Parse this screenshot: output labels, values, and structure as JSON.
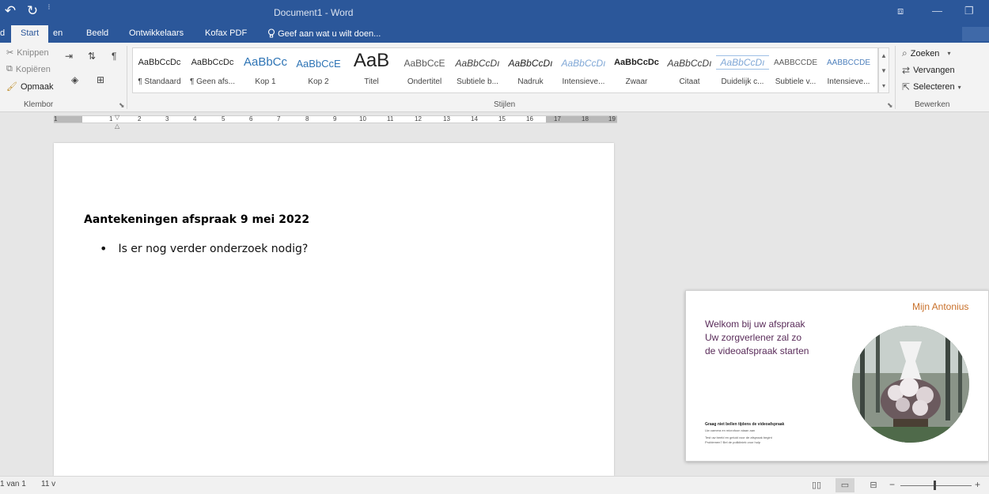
{
  "titlebar": {
    "title": "Document1 - Word",
    "qat": {
      "undo_icon": "↶",
      "redo_icon": "↻",
      "more_icon": "⁝"
    },
    "window_icons": {
      "ribbon_options": "⧈",
      "minimize": "—",
      "restore": "❐"
    }
  },
  "tabs": {
    "partial_left": "d",
    "items": [
      {
        "label": "Start"
      },
      {
        "label": "en"
      },
      {
        "label": "Beeld"
      },
      {
        "label": "Ontwikkelaars"
      },
      {
        "label": "Kofax PDF"
      }
    ],
    "tell_me": "Geef aan wat u wilt doen..."
  },
  "ribbon": {
    "clipboard": {
      "cut": "Knippen",
      "copy": "Kopiëren",
      "format_painter": "Opmaak",
      "group_label": "Klembor"
    },
    "styles": {
      "group_label": "Stijlen",
      "items": [
        {
          "sample": "AaBbCcDc",
          "name": "¶ Standaard"
        },
        {
          "sample": "AaBbCcDc",
          "name": "¶ Geen afs..."
        },
        {
          "sample": "AaBbCc",
          "name": "Kop 1"
        },
        {
          "sample": "AaBbCcE",
          "name": "Kop 2"
        },
        {
          "sample": "AaB",
          "name": "Titel"
        },
        {
          "sample": "AaBbCcE",
          "name": "Ondertitel"
        },
        {
          "sample": "AaBbCcDı",
          "name": "Subtiele b..."
        },
        {
          "sample": "AaBbCcDı",
          "name": "Nadruk"
        },
        {
          "sample": "AaBbCcDı",
          "name": "Intensieve..."
        },
        {
          "sample": "AaBbCcDc",
          "name": "Zwaar"
        },
        {
          "sample": "AaBbCcDı",
          "name": "Citaat"
        },
        {
          "sample": "AaBbCcDı",
          "name": "Duidelijk c..."
        },
        {
          "sample": "AABBCCDE",
          "name": "Subtiele v..."
        },
        {
          "sample": "AABBCCDE",
          "name": "Intensieve..."
        }
      ]
    },
    "editing": {
      "find": "Zoeken",
      "replace": "Vervangen",
      "select": "Selecteren",
      "group_label": "Bewerken"
    }
  },
  "ruler": {
    "numbers": [
      "1",
      "1",
      "2",
      "3",
      "4",
      "5",
      "6",
      "7",
      "8",
      "9",
      "10",
      "11",
      "12",
      "13",
      "14",
      "15",
      "16",
      "17",
      "18",
      "19"
    ]
  },
  "document": {
    "heading": "Aantekeningen afspraak 9 mei 2022",
    "bullets": [
      "Is er nog verder onderzoek nodig?"
    ]
  },
  "video": {
    "brand": "Mijn Antonius",
    "welcome_lines": [
      "Welkom bij uw afspraak",
      "Uw zorgverlener zal zo",
      "de videoafspraak starten"
    ],
    "small_bold": "Graag niet bellen tijdens de videoafspraak",
    "small_lines": [
      "Uw camera en microfoon staan aan",
      "Test uw beeld en geluid voor de afspraak begint",
      "Problemen? Bel de polikliniek voor hulp"
    ]
  },
  "statusbar": {
    "page": "1 van 1",
    "words": "11 v"
  },
  "colors": {
    "word_blue": "#2b579a",
    "brand_orange": "#c8702a",
    "welcome_purple": "#5a2c5a"
  }
}
